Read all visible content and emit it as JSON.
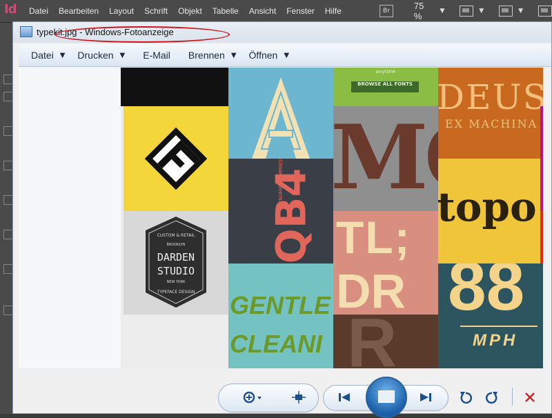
{
  "indesign": {
    "logo": "Id",
    "menu": [
      "Datei",
      "Bearbeiten",
      "Layout",
      "Schrift",
      "Objekt",
      "Tabelle",
      "Ansicht",
      "Fenster",
      "Hilfe"
    ],
    "bridge_badge": "Br",
    "zoom": "75 %"
  },
  "viewer": {
    "title": "typekit.jpg - Windows-Fotoanzeige",
    "menu": [
      {
        "label": "Datei",
        "has_caret": true
      },
      {
        "label": "Drucken",
        "has_caret": true
      },
      {
        "label": "E-Mail",
        "has_caret": false
      },
      {
        "label": "Brennen",
        "has_caret": true
      },
      {
        "label": "Öffnen",
        "has_caret": true
      }
    ]
  },
  "photo": {
    "anytime": "anytime",
    "browse_fonts": "BROWSE ALL FONTS",
    "deus": "DEUS",
    "ex_machina": "EX MACHINA",
    "topo": "topo",
    "darden_top": "CUSTOM & RETAIL",
    "darden_brooklyn": "BROOKLYN",
    "darden_1": "DARDEN",
    "darden_2": "STUDIO",
    "darden_newyork": "NEW YORK",
    "darden_bottom": "TYPEFACE DESIGN",
    "qb4": "QB4",
    "qb4_sub": "DYNAMIC COMPRESSION RANGE",
    "gentle": "GENTLE",
    "cleani": "CLEANI",
    "mc": "MC",
    "tl": "TL;",
    "dr": "DR",
    "n88": "88",
    "mph": "MPH"
  },
  "controls": {
    "icons": [
      "zoom-icon",
      "fit-icon",
      "previous-icon",
      "slideshow-icon",
      "next-icon",
      "rotate-left-icon",
      "rotate-right-icon",
      "delete-icon"
    ]
  },
  "colors": {
    "annotation_red": "#d0101a",
    "indesign_pink": "#c94f78",
    "accent_blue": "#1d4f8c"
  }
}
